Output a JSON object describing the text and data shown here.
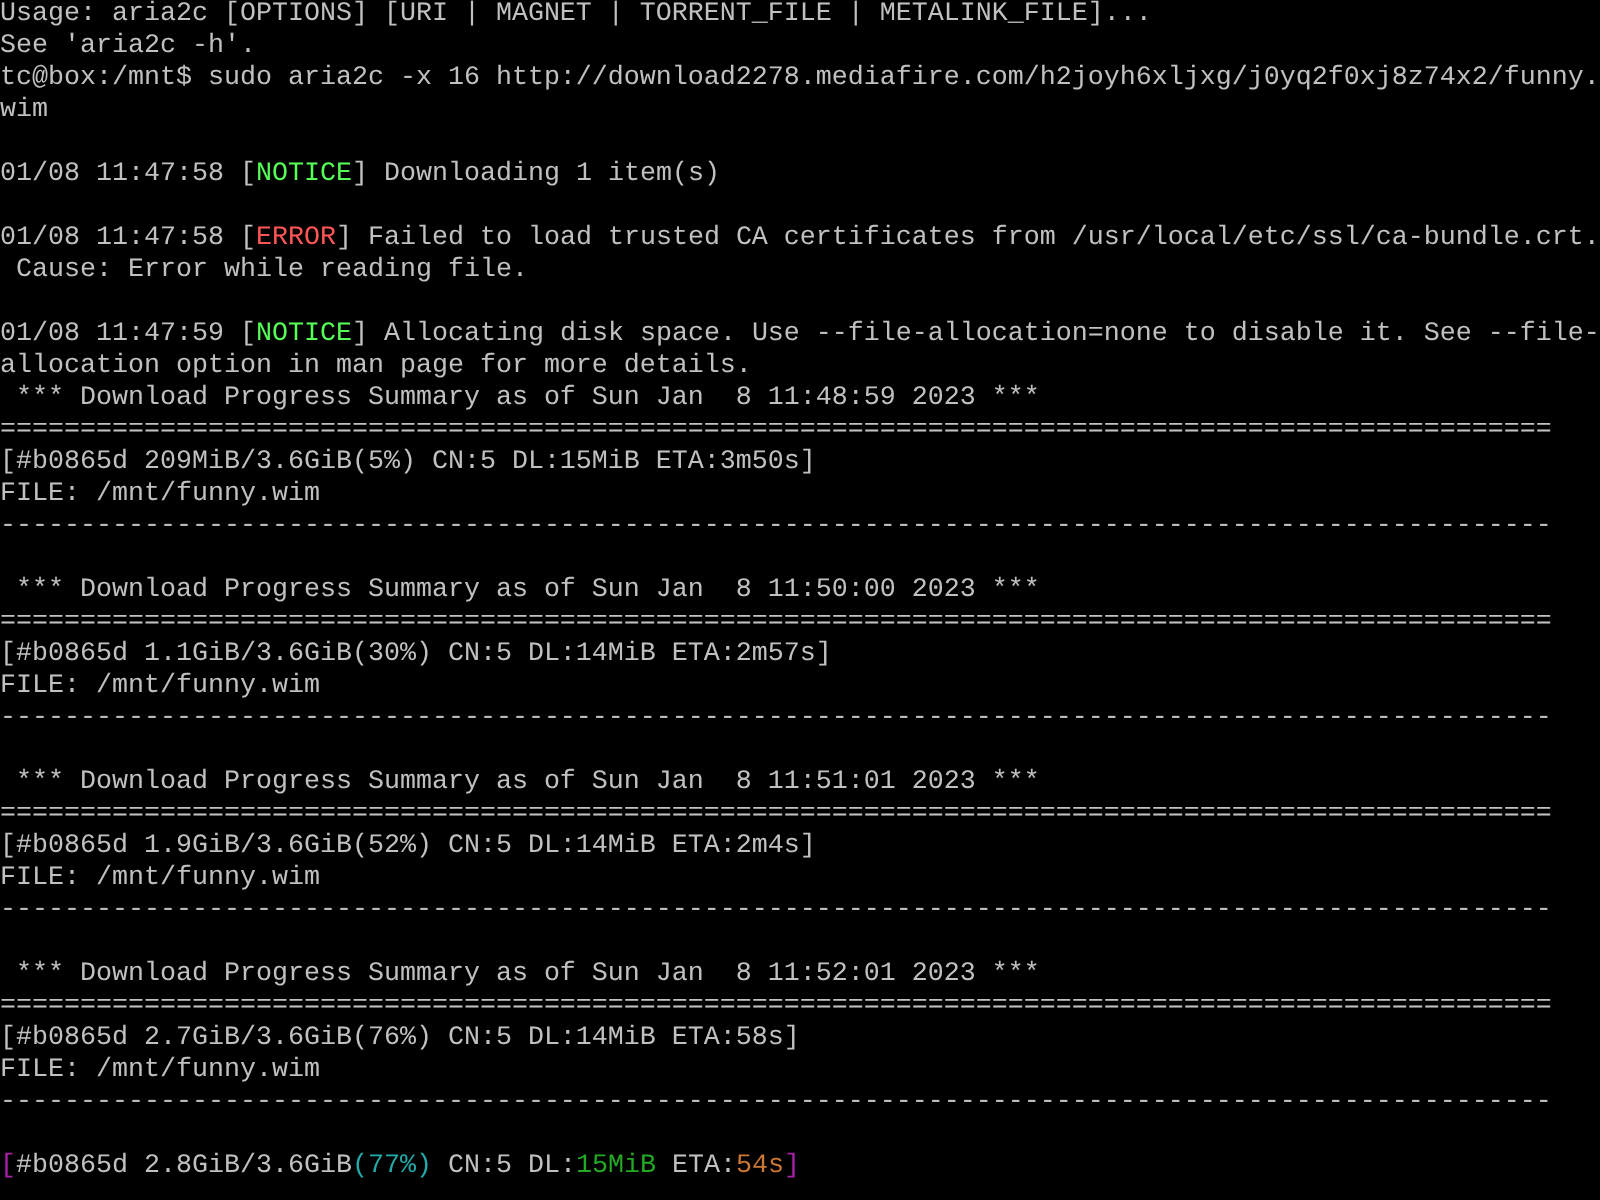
{
  "terminal": {
    "lines": [
      {
        "kind": "text",
        "segments": [
          {
            "text": "Usage: aria2c [OPTIONS] [URI | MAGNET | TORRENT_FILE | METALINK_FILE]..."
          }
        ]
      },
      {
        "kind": "text",
        "segments": [
          {
            "text": "See 'aria2c -h'."
          }
        ]
      },
      {
        "kind": "text",
        "segments": [
          {
            "text": "tc@box:/mnt$ sudo aria2c -x 16 http://download2278.mediafire.com/h2joyh6xljxg/j0yq2f0xj8z74x2/funny."
          }
        ]
      },
      {
        "kind": "text",
        "segments": [
          {
            "text": "wim"
          }
        ]
      },
      {
        "kind": "blank"
      },
      {
        "kind": "text",
        "segments": [
          {
            "text": "01/08 11:47:58 ["
          },
          {
            "text": "NOTICE",
            "color": "#55ff55"
          },
          {
            "text": "] Downloading 1 item(s)"
          }
        ]
      },
      {
        "kind": "blank"
      },
      {
        "kind": "text",
        "segments": [
          {
            "text": "01/08 11:47:58 ["
          },
          {
            "text": "ERROR",
            "color": "#ff5555"
          },
          {
            "text": "] Failed to load trusted CA certificates from /usr/local/etc/ssl/ca-bundle.crt."
          }
        ]
      },
      {
        "kind": "text",
        "segments": [
          {
            "text": " Cause: Error while reading file."
          }
        ]
      },
      {
        "kind": "blank"
      },
      {
        "kind": "text",
        "segments": [
          {
            "text": "01/08 11:47:59 ["
          },
          {
            "text": "NOTICE",
            "color": "#55ff55"
          },
          {
            "text": "] Allocating disk space. Use --file-allocation=none to disable it. See --file-"
          }
        ]
      },
      {
        "kind": "text",
        "segments": [
          {
            "text": "allocation option in man page for more details."
          }
        ]
      },
      {
        "kind": "text",
        "segments": [
          {
            "text": " *** Download Progress Summary as of Sun Jan  8 11:48:59 2023 ***"
          }
        ]
      },
      {
        "kind": "text",
        "segments": [
          {
            "text": "================================================================================================="
          }
        ]
      },
      {
        "kind": "text",
        "segments": [
          {
            "text": "[#b0865d 209MiB/3.6GiB(5%) CN:5 DL:15MiB ETA:3m50s]"
          }
        ]
      },
      {
        "kind": "text",
        "segments": [
          {
            "text": "FILE: /mnt/funny.wim"
          }
        ]
      },
      {
        "kind": "text",
        "segments": [
          {
            "text": "-------------------------------------------------------------------------------------------------"
          }
        ]
      },
      {
        "kind": "blank"
      },
      {
        "kind": "text",
        "segments": [
          {
            "text": " *** Download Progress Summary as of Sun Jan  8 11:50:00 2023 ***"
          }
        ]
      },
      {
        "kind": "text",
        "segments": [
          {
            "text": "================================================================================================="
          }
        ]
      },
      {
        "kind": "text",
        "segments": [
          {
            "text": "[#b0865d 1.1GiB/3.6GiB(30%) CN:5 DL:14MiB ETA:2m57s]"
          }
        ]
      },
      {
        "kind": "text",
        "segments": [
          {
            "text": "FILE: /mnt/funny.wim"
          }
        ]
      },
      {
        "kind": "text",
        "segments": [
          {
            "text": "-------------------------------------------------------------------------------------------------"
          }
        ]
      },
      {
        "kind": "blank"
      },
      {
        "kind": "text",
        "segments": [
          {
            "text": " *** Download Progress Summary as of Sun Jan  8 11:51:01 2023 ***"
          }
        ]
      },
      {
        "kind": "text",
        "segments": [
          {
            "text": "================================================================================================="
          }
        ]
      },
      {
        "kind": "text",
        "segments": [
          {
            "text": "[#b0865d 1.9GiB/3.6GiB(52%) CN:5 DL:14MiB ETA:2m4s]"
          }
        ]
      },
      {
        "kind": "text",
        "segments": [
          {
            "text": "FILE: /mnt/funny.wim"
          }
        ]
      },
      {
        "kind": "text",
        "segments": [
          {
            "text": "-------------------------------------------------------------------------------------------------"
          }
        ]
      },
      {
        "kind": "blank"
      },
      {
        "kind": "text",
        "segments": [
          {
            "text": " *** Download Progress Summary as of Sun Jan  8 11:52:01 2023 ***"
          }
        ]
      },
      {
        "kind": "text",
        "segments": [
          {
            "text": "================================================================================================="
          }
        ]
      },
      {
        "kind": "text",
        "segments": [
          {
            "text": "[#b0865d 2.7GiB/3.6GiB(76%) CN:5 DL:14MiB ETA:58s]"
          }
        ]
      },
      {
        "kind": "text",
        "segments": [
          {
            "text": "FILE: /mnt/funny.wim"
          }
        ]
      },
      {
        "kind": "text",
        "segments": [
          {
            "text": "-------------------------------------------------------------------------------------------------"
          }
        ]
      },
      {
        "kind": "blank"
      },
      {
        "kind": "text",
        "segments": [
          {
            "text": "[",
            "color": "#aa22aa"
          },
          {
            "text": "#b0865d 2.8GiB/3.6GiB"
          },
          {
            "text": "(77%)",
            "color": "#22aaaa"
          },
          {
            "text": " CN:5 DL:"
          },
          {
            "text": "15MiB",
            "color": "#22aa22"
          },
          {
            "text": " ETA:"
          },
          {
            "text": "54s",
            "color": "#cc7733"
          },
          {
            "text": "]",
            "color": "#aa22aa"
          }
        ]
      }
    ]
  }
}
